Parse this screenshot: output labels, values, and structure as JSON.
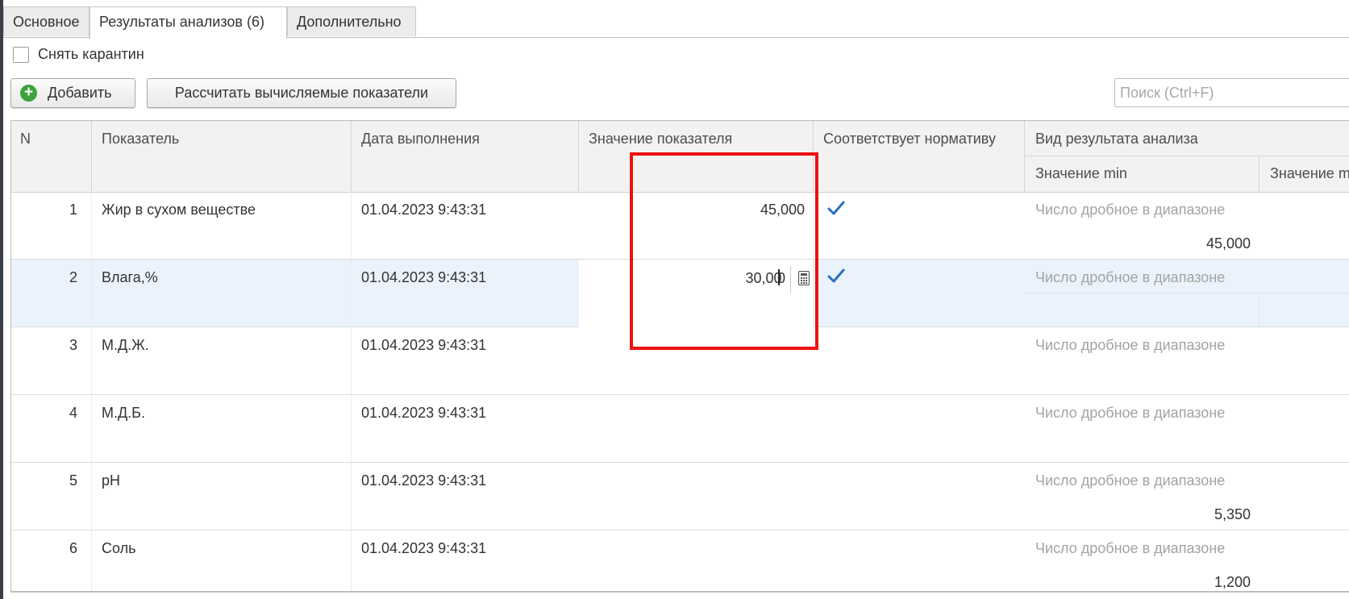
{
  "tabs": [
    {
      "label": "Основное"
    },
    {
      "label": "Результаты анализов (6)"
    },
    {
      "label": "Дополнительно"
    }
  ],
  "quarantine_checkbox": {
    "label": "Снять карантин",
    "checked": false
  },
  "toolbar": {
    "add_label": "Добавить",
    "calc_label": "Рассчитать вычисляемые показатели",
    "search_placeholder": "Поиск (Ctrl+F)"
  },
  "columns": {
    "n": "N",
    "indicator": "Показатель",
    "date": "Дата выполнения",
    "value": "Значение показателя",
    "norm": "Соответствует нормативу",
    "result_type": "Вид результата анализа",
    "min": "Значение min",
    "max": "Значение m"
  },
  "rows": [
    {
      "n": "1",
      "indicator": "Жир в сухом веществе",
      "date": "01.04.2023 9:43:31",
      "value": "45,000",
      "norm": true,
      "result_type": "Число дробное в диапазоне",
      "min": "45,000"
    },
    {
      "n": "2",
      "indicator": "Влага,%",
      "date": "01.04.2023 9:43:31",
      "value_before_caret": "30,00",
      "value_after_caret": "0",
      "norm": true,
      "result_type": "Число дробное в диапазоне",
      "min": ""
    },
    {
      "n": "3",
      "indicator": "М.Д.Ж.",
      "date": "01.04.2023 9:43:31",
      "value": "",
      "norm": false,
      "result_type": "Число дробное в диапазоне",
      "min": ""
    },
    {
      "n": "4",
      "indicator": "М.Д.Б.",
      "date": "01.04.2023 9:43:31",
      "value": "",
      "norm": false,
      "result_type": "Число дробное в диапазоне",
      "min": ""
    },
    {
      "n": "5",
      "indicator": "pH",
      "date": "01.04.2023 9:43:31",
      "value": "",
      "norm": false,
      "result_type": "Число дробное в диапазоне",
      "min": "5,350"
    },
    {
      "n": "6",
      "indicator": "Соль",
      "date": "01.04.2023 9:43:31",
      "value": "",
      "norm": false,
      "result_type": "Число дробное в диапазоне",
      "min": "1,200"
    }
  ],
  "selected_row": 2,
  "colors": {
    "accent_check": "#2a6fc0",
    "highlight": "#ee1111",
    "selected_row": "#eaf3fb"
  }
}
